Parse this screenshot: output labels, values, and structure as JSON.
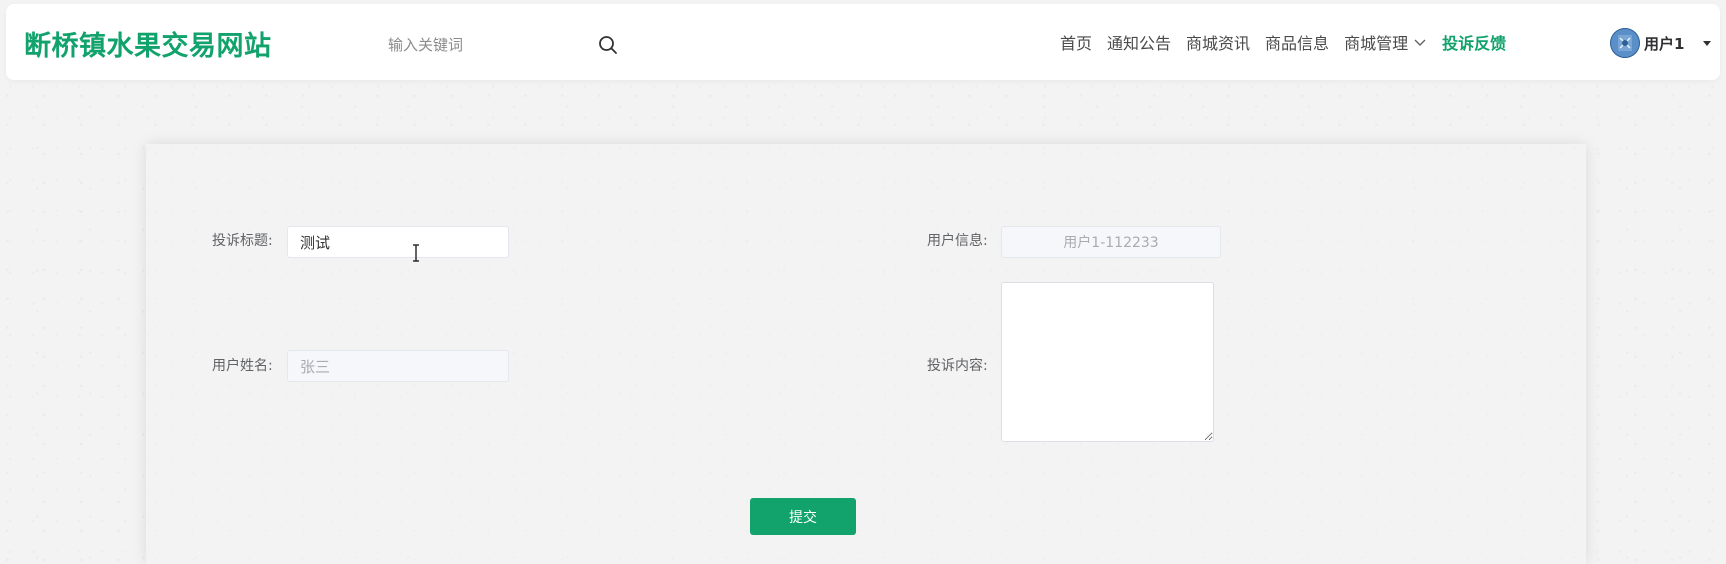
{
  "header": {
    "brand": "断桥镇水果交易网站",
    "search": {
      "placeholder": "输入关键词",
      "icon": "search-icon"
    },
    "nav": [
      {
        "label": "首页",
        "active": false
      },
      {
        "label": "通知公告",
        "active": false
      },
      {
        "label": "商城资讯",
        "active": false
      },
      {
        "label": "商品信息",
        "active": false
      },
      {
        "label": "商城管理",
        "active": false,
        "has_dropdown": true
      },
      {
        "label": "投诉反馈",
        "active": true
      }
    ],
    "user": {
      "name": "用户1",
      "avatar_icon": "avatar"
    }
  },
  "form": {
    "complaint_title": {
      "label": "投诉标题:",
      "value": "测试"
    },
    "user_info": {
      "label": "用户信息:",
      "value": "用户1-112233"
    },
    "user_name": {
      "label": "用户姓名:",
      "value": "张三"
    },
    "complaint_content": {
      "label": "投诉内容:",
      "value": ""
    },
    "submit_label": "提交"
  },
  "colors": {
    "accent": "#12a26b",
    "text": "#606266",
    "background": "#f3f3f3"
  }
}
